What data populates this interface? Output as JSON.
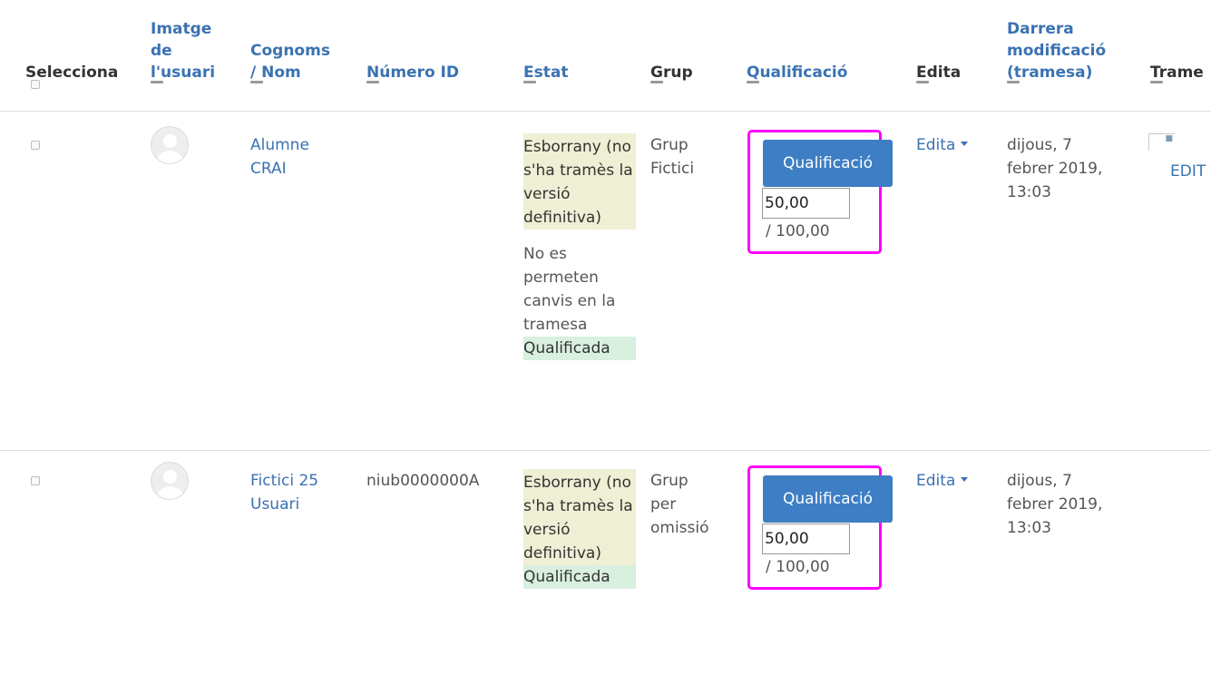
{
  "headers": {
    "select": "Selecciona",
    "picture": "Imatge de l'usuari",
    "fullname": "Cognoms / Nom",
    "idnumber": "Número ID",
    "status": "Estat",
    "group": "Grup",
    "grade": "Qualificació",
    "edit": "Edita",
    "lastmodified": "Darrera modificació (tramesa)",
    "submission": "Trame"
  },
  "rows": [
    {
      "fullname": "Alumne CRAI",
      "idnumber": "",
      "status_draft": "Esborrany (no s'ha tramès la versió definitiva)",
      "status_note": "No es permeten canvis en la tramesa",
      "status_graded": "Qualificada",
      "group": "Grup Fictici",
      "grade_button": "Qualificació",
      "grade_value": "50,00",
      "grade_max": "/ 100,00",
      "edit_menu": "Edita",
      "lastmodified": "dijous, 7 febrer 2019, 13:03",
      "submission_link": "EDIT"
    },
    {
      "fullname": "Fictici 25 Usuari",
      "idnumber": "niub0000000A",
      "status_draft": "Esborrany (no s'ha tramès la versió definitiva)",
      "status_graded": "Qualificada",
      "group": "Grup per omissió",
      "grade_button": "Qualificació",
      "grade_value": "50,00",
      "grade_max": "/ 100,00",
      "edit_menu": "Edita",
      "lastmodified": "dijous, 7 febrer 2019, 13:03"
    }
  ],
  "colors": {
    "link": "#3a72b2",
    "grade_button": "#3d7ec4",
    "highlight_box": "#ff00ff",
    "status_draft_bg": "#efefd5",
    "status_graded_bg": "#d9efdf"
  }
}
